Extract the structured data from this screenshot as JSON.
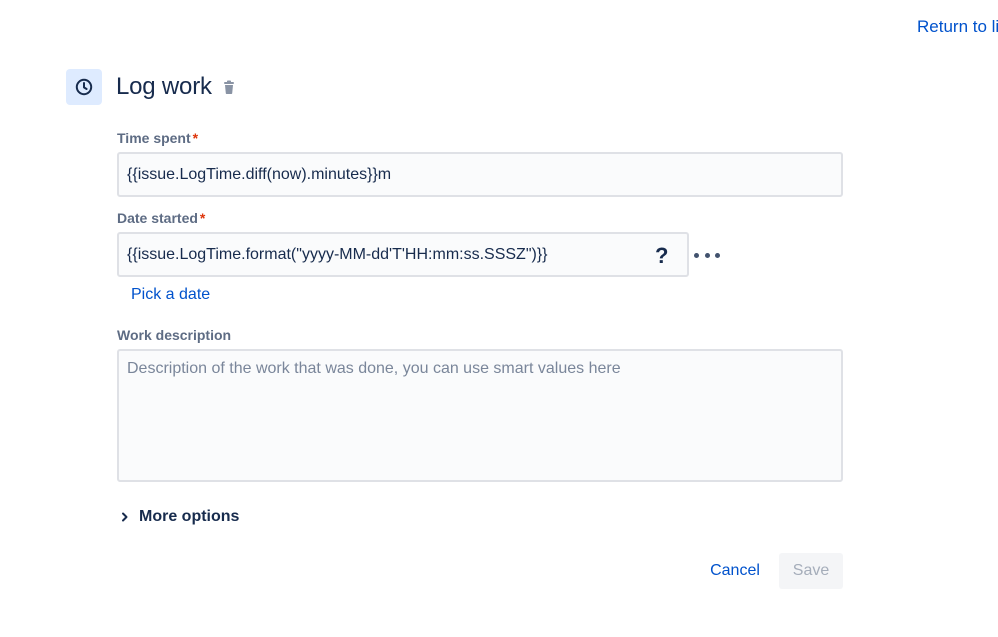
{
  "header": {
    "return_link": "Return to li",
    "title": "Log work",
    "header_icon": "clock-icon",
    "delete_icon": "trash-icon"
  },
  "form": {
    "time_spent": {
      "label": "Time spent",
      "required_mark": "*",
      "value": "{{issue.LogTime.diff(now).minutes}}m"
    },
    "date_started": {
      "label": "Date started",
      "required_mark": "*",
      "value": "{{issue.LogTime.format(\"yyyy-MM-dd'T'HH:mm:ss.SSSZ\")}}",
      "help_label": "?",
      "more_icon": "more-dots-icon",
      "pick_date_link": "Pick a date"
    },
    "work_description": {
      "label": "Work description",
      "value": "",
      "placeholder": "Description of the work that was done, you can use smart values here"
    },
    "more_options": {
      "label": "More options",
      "icon": "chevron-right-icon"
    }
  },
  "actions": {
    "cancel_label": "Cancel",
    "save_label": "Save"
  },
  "colors": {
    "accent": "#0052cc",
    "text": "#172b4d",
    "label": "#5e6c84",
    "required": "#de350b",
    "icon_bg": "#deebff",
    "input_border": "#dfe1e6",
    "input_bg": "#fafbfc",
    "disabled_text": "#a5adba",
    "disabled_bg": "#f4f5f7"
  }
}
